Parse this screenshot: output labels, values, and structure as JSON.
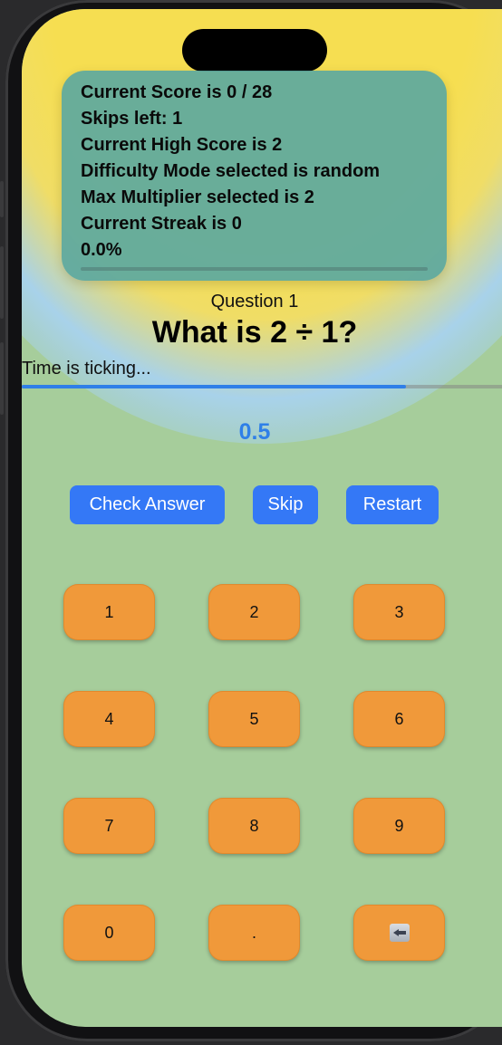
{
  "stats": {
    "score": "Current Score is 0 / 28",
    "skips": "Skips left: 1",
    "high_score": "Current High Score is 2",
    "difficulty": "Difficulty Mode selected is random",
    "max_multiplier": "Max Multiplier selected is 2",
    "streak": "Current Streak is 0",
    "percentage": "0.0%",
    "progress_fraction": 0.0
  },
  "question": {
    "number_label": "Question 1",
    "text": "What is 2 ÷ 1?"
  },
  "timer": {
    "label": "Time is ticking...",
    "remaining_fraction": 0.8
  },
  "answer": {
    "value": "0.5"
  },
  "actions": {
    "check_label": "Check Answer",
    "skip_label": "Skip",
    "restart_label": "Restart"
  },
  "keypad": {
    "keys": [
      "1",
      "2",
      "3",
      "4",
      "5",
      "6",
      "7",
      "8",
      "9",
      "0",
      ".",
      "backspace-icon"
    ]
  },
  "colors": {
    "accent": "#3478f6",
    "key": "#f0993a",
    "background": "#a6cd9b",
    "stats_card": "#5ca8a0"
  }
}
